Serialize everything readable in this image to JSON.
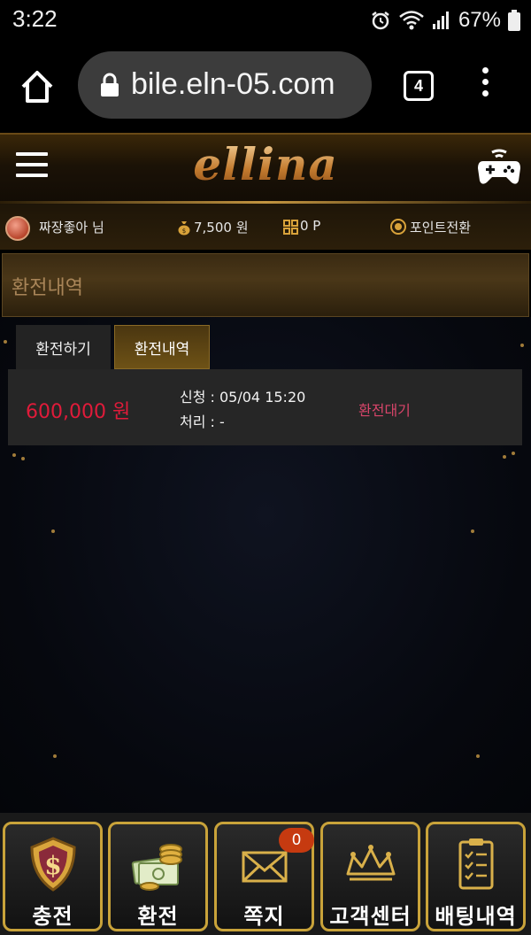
{
  "status_bar": {
    "time": "3:22",
    "battery": "67%"
  },
  "browser": {
    "url": "bile.eln-05.com",
    "tab_count": "4"
  },
  "site": {
    "logo": "ellina"
  },
  "info_bar": {
    "user": "짜장좋아 님",
    "money": "7,500 원",
    "points": "0 P",
    "exchange": "포인트전환"
  },
  "page": {
    "title": "환전내역"
  },
  "tabs": [
    {
      "label": "환전하기",
      "active": false
    },
    {
      "label": "환전내역",
      "active": true
    }
  ],
  "records": [
    {
      "amount": "600,000 원",
      "request": "신청 : 05/04 15:20",
      "process": "처리 : -",
      "status": "환전대기"
    }
  ],
  "bottom_nav": [
    {
      "label": "충전",
      "icon": "shield-dollar-icon"
    },
    {
      "label": "환전",
      "icon": "money-stack-icon"
    },
    {
      "label": "쪽지",
      "icon": "envelope-icon",
      "badge": "0"
    },
    {
      "label": "고객센터",
      "icon": "crown-icon"
    },
    {
      "label": "배팅내역",
      "icon": "clipboard-checklist-icon"
    }
  ],
  "colors": {
    "gold": "#c9a33a",
    "amount_red": "#e01b3a",
    "status_pink": "#d8456a"
  }
}
